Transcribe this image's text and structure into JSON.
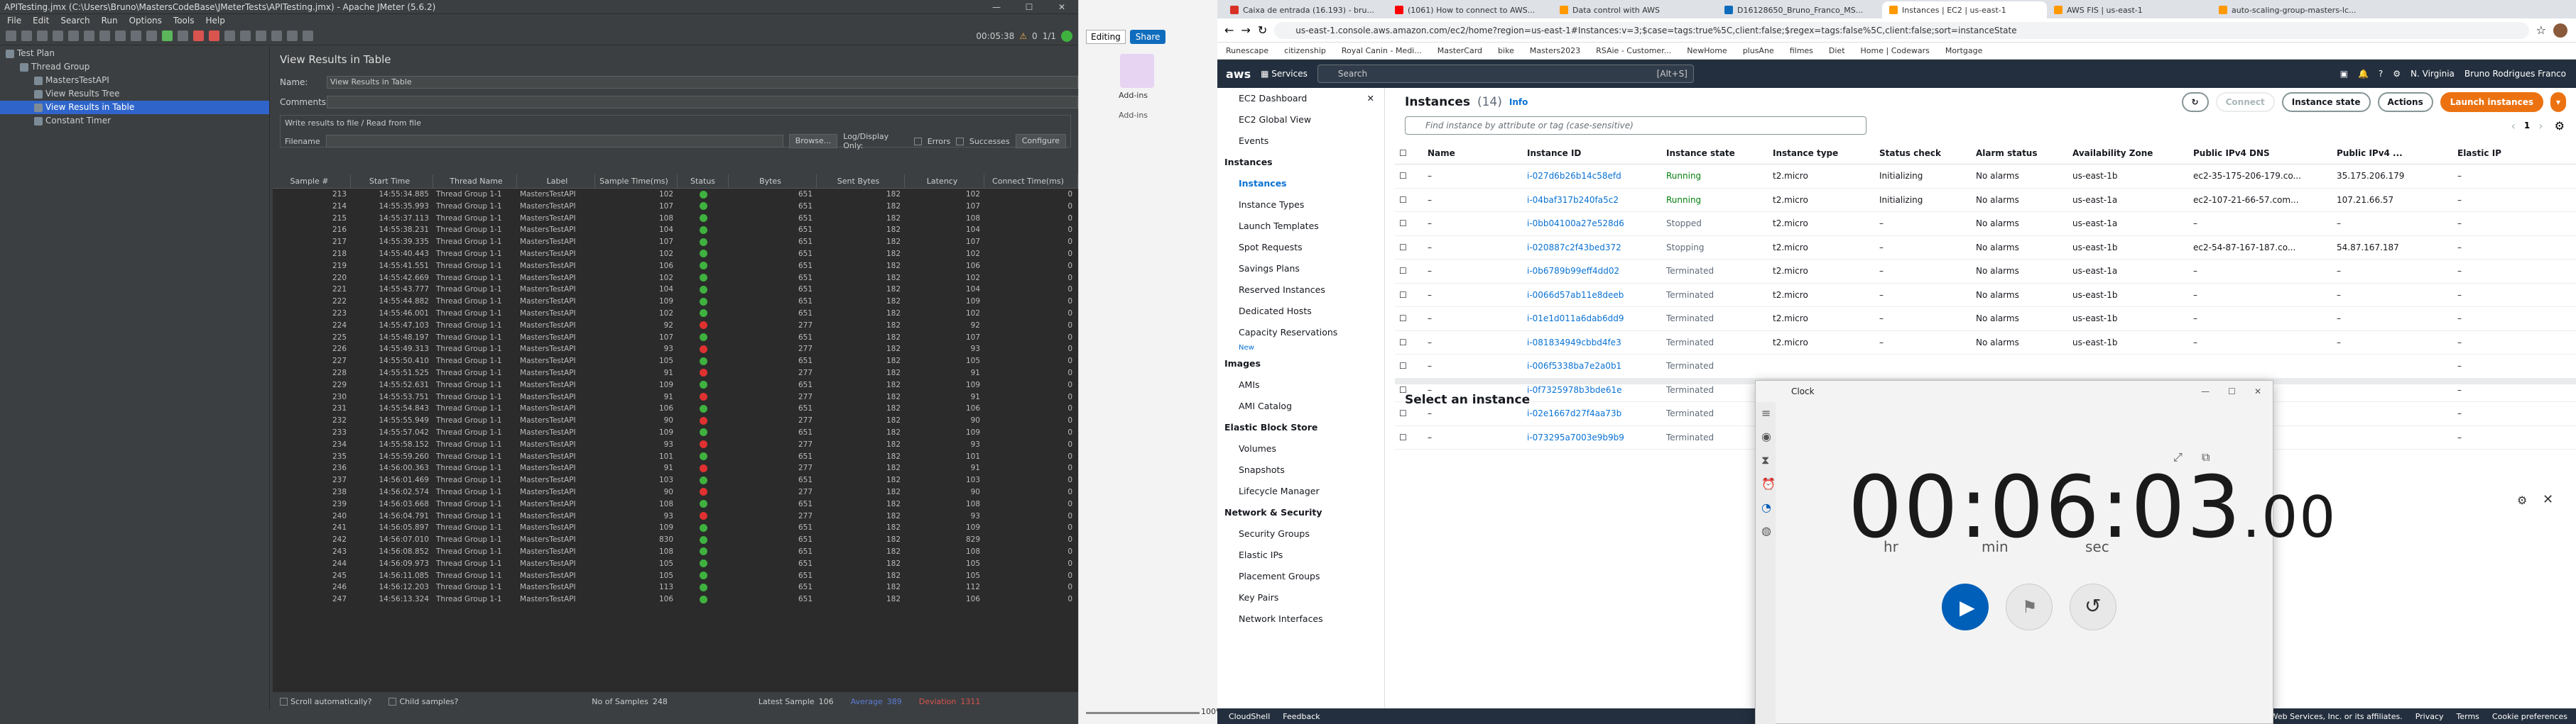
{
  "jmeter": {
    "title": "APITesting.jmx (C:\\Users\\Bruno\\MastersCodeBase\\JMeterTests\\APITesting.jmx) - Apache JMeter (5.6.2)",
    "menu": [
      "File",
      "Edit",
      "Search",
      "Run",
      "Options",
      "Tools",
      "Help"
    ],
    "timer": "00:05:38",
    "warn_count": "0",
    "threads": "1/1",
    "tree": [
      {
        "label": "Test Plan",
        "indent": 0,
        "sel": false
      },
      {
        "label": "Thread Group",
        "indent": 1,
        "sel": false
      },
      {
        "label": "MastersTestAPI",
        "indent": 2,
        "sel": false
      },
      {
        "label": "View Results Tree",
        "indent": 2,
        "sel": false
      },
      {
        "label": "View Results in Table",
        "indent": 2,
        "sel": true
      },
      {
        "label": "Constant Timer",
        "indent": 2,
        "sel": false
      }
    ],
    "panel_title": "View Results in Table",
    "name_label": "Name:",
    "name_value": "View Results in Table",
    "comments_label": "Comments:",
    "write_all": "Write results to file / Read from file",
    "filename_label": "Filename",
    "browse_label": "Browse...",
    "log_display": "Log/Display Only:",
    "errors_label": "Errors",
    "successes_label": "Successes",
    "configure_label": "Configure",
    "columns": [
      "Sample #",
      "Start Time",
      "Thread Name",
      "Label",
      "Sample Time(ms)",
      "Status",
      "Bytes",
      "Sent Bytes",
      "Latency",
      "Connect Time(ms)"
    ],
    "rows": [
      [
        "213",
        "14:55:34.885",
        "Thread Group 1-1",
        "MastersTestAPI",
        "102",
        "ok",
        "651",
        "182",
        "102",
        "0"
      ],
      [
        "214",
        "14:55:35.993",
        "Thread Group 1-1",
        "MastersTestAPI",
        "107",
        "ok",
        "651",
        "182",
        "107",
        "0"
      ],
      [
        "215",
        "14:55:37.113",
        "Thread Group 1-1",
        "MastersTestAPI",
        "108",
        "ok",
        "651",
        "182",
        "108",
        "0"
      ],
      [
        "216",
        "14:55:38.231",
        "Thread Group 1-1",
        "MastersTestAPI",
        "104",
        "ok",
        "651",
        "182",
        "104",
        "0"
      ],
      [
        "217",
        "14:55:39.335",
        "Thread Group 1-1",
        "MastersTestAPI",
        "107",
        "ok",
        "651",
        "182",
        "107",
        "0"
      ],
      [
        "218",
        "14:55:40.443",
        "Thread Group 1-1",
        "MastersTestAPI",
        "102",
        "ok",
        "651",
        "182",
        "102",
        "0"
      ],
      [
        "219",
        "14:55:41.551",
        "Thread Group 1-1",
        "MastersTestAPI",
        "106",
        "ok",
        "651",
        "182",
        "106",
        "0"
      ],
      [
        "220",
        "14:55:42.669",
        "Thread Group 1-1",
        "MastersTestAPI",
        "102",
        "ok",
        "651",
        "182",
        "102",
        "0"
      ],
      [
        "221",
        "14:55:43.777",
        "Thread Group 1-1",
        "MastersTestAPI",
        "104",
        "ok",
        "651",
        "182",
        "104",
        "0"
      ],
      [
        "222",
        "14:55:44.882",
        "Thread Group 1-1",
        "MastersTestAPI",
        "109",
        "ok",
        "651",
        "182",
        "109",
        "0"
      ],
      [
        "223",
        "14:55:46.001",
        "Thread Group 1-1",
        "MastersTestAPI",
        "102",
        "ok",
        "651",
        "182",
        "102",
        "0"
      ],
      [
        "224",
        "14:55:47.103",
        "Thread Group 1-1",
        "MastersTestAPI",
        "92",
        "bad",
        "277",
        "182",
        "92",
        "0"
      ],
      [
        "225",
        "14:55:48.197",
        "Thread Group 1-1",
        "MastersTestAPI",
        "107",
        "ok",
        "651",
        "182",
        "107",
        "0"
      ],
      [
        "226",
        "14:55:49.313",
        "Thread Group 1-1",
        "MastersTestAPI",
        "93",
        "bad",
        "277",
        "182",
        "93",
        "0"
      ],
      [
        "227",
        "14:55:50.410",
        "Thread Group 1-1",
        "MastersTestAPI",
        "105",
        "ok",
        "651",
        "182",
        "105",
        "0"
      ],
      [
        "228",
        "14:55:51.525",
        "Thread Group 1-1",
        "MastersTestAPI",
        "91",
        "bad",
        "277",
        "182",
        "91",
        "0"
      ],
      [
        "229",
        "14:55:52.631",
        "Thread Group 1-1",
        "MastersTestAPI",
        "109",
        "ok",
        "651",
        "182",
        "109",
        "0"
      ],
      [
        "230",
        "14:55:53.751",
        "Thread Group 1-1",
        "MastersTestAPI",
        "91",
        "bad",
        "277",
        "182",
        "91",
        "0"
      ],
      [
        "231",
        "14:55:54.843",
        "Thread Group 1-1",
        "MastersTestAPI",
        "106",
        "ok",
        "651",
        "182",
        "106",
        "0"
      ],
      [
        "232",
        "14:55:55.949",
        "Thread Group 1-1",
        "MastersTestAPI",
        "90",
        "bad",
        "277",
        "182",
        "90",
        "0"
      ],
      [
        "233",
        "14:55:57.042",
        "Thread Group 1-1",
        "MastersTestAPI",
        "109",
        "ok",
        "651",
        "182",
        "109",
        "0"
      ],
      [
        "234",
        "14:55:58.152",
        "Thread Group 1-1",
        "MastersTestAPI",
        "93",
        "bad",
        "277",
        "182",
        "93",
        "0"
      ],
      [
        "235",
        "14:55:59.260",
        "Thread Group 1-1",
        "MastersTestAPI",
        "101",
        "ok",
        "651",
        "182",
        "101",
        "0"
      ],
      [
        "236",
        "14:56:00.363",
        "Thread Group 1-1",
        "MastersTestAPI",
        "91",
        "bad",
        "277",
        "182",
        "91",
        "0"
      ],
      [
        "237",
        "14:56:01.469",
        "Thread Group 1-1",
        "MastersTestAPI",
        "103",
        "ok",
        "651",
        "182",
        "103",
        "0"
      ],
      [
        "238",
        "14:56:02.574",
        "Thread Group 1-1",
        "MastersTestAPI",
        "90",
        "bad",
        "277",
        "182",
        "90",
        "0"
      ],
      [
        "239",
        "14:56:03.668",
        "Thread Group 1-1",
        "MastersTestAPI",
        "108",
        "ok",
        "651",
        "182",
        "108",
        "0"
      ],
      [
        "240",
        "14:56:04.791",
        "Thread Group 1-1",
        "MastersTestAPI",
        "93",
        "bad",
        "277",
        "182",
        "93",
        "0"
      ],
      [
        "241",
        "14:56:05.897",
        "Thread Group 1-1",
        "MastersTestAPI",
        "109",
        "ok",
        "651",
        "182",
        "109",
        "0"
      ],
      [
        "242",
        "14:56:07.010",
        "Thread Group 1-1",
        "MastersTestAPI",
        "830",
        "ok",
        "651",
        "182",
        "829",
        "0"
      ],
      [
        "243",
        "14:56:08.852",
        "Thread Group 1-1",
        "MastersTestAPI",
        "108",
        "ok",
        "651",
        "182",
        "108",
        "0"
      ],
      [
        "244",
        "14:56:09.973",
        "Thread Group 1-1",
        "MastersTestAPI",
        "105",
        "ok",
        "651",
        "182",
        "105",
        "0"
      ],
      [
        "245",
        "14:56:11.085",
        "Thread Group 1-1",
        "MastersTestAPI",
        "105",
        "ok",
        "651",
        "182",
        "105",
        "0"
      ],
      [
        "246",
        "14:56:12.203",
        "Thread Group 1-1",
        "MastersTestAPI",
        "113",
        "ok",
        "651",
        "182",
        "112",
        "0"
      ],
      [
        "247",
        "14:56:13.324",
        "Thread Group 1-1",
        "MastersTestAPI",
        "106",
        "ok",
        "651",
        "182",
        "106",
        "0"
      ]
    ],
    "scroll_auto": "Scroll automatically?",
    "child_samples": "Child samples?",
    "no_samples_label": "No of Samples",
    "no_samples": "248",
    "latest_label": "Latest Sample",
    "latest": "106",
    "average_label": "Average",
    "average": "389",
    "deviation_label": "Deviation",
    "deviation": "1311"
  },
  "office": {
    "editing": "Editing",
    "share": "Share",
    "addins": "Add-ins",
    "addins2": "Add-ins",
    "zoom": "100%"
  },
  "chrome": {
    "tabs": [
      "Caixa de entrada (16.193) - bru...",
      "(1061) How to connect to AWS...",
      "Data control with AWS",
      "D16128650_Bruno_Franco_MS...",
      "Instances | EC2 | us-east-1",
      "AWS FIS | us-east-1",
      "auto-scaling-group-masters-lc..."
    ],
    "active_tab": 4,
    "url": "us-east-1.console.aws.amazon.com/ec2/home?region=us-east-1#Instances:v=3;$case=tags:true%5C,client:false;$regex=tags:false%5C,client:false;sort=instanceState",
    "bookmarks": [
      "Runescape",
      "citizenship",
      "Royal Canin - Medi...",
      "MasterCard",
      "bike",
      "Masters2023",
      "RSAie - Customer...",
      "NewHome",
      "plusAne",
      "filmes",
      "Diet",
      "Home | Codewars",
      "Mortgage"
    ]
  },
  "aws": {
    "services": "Services",
    "search_placeholder": "Search",
    "search_shortcut": "[Alt+S]",
    "region": "N. Virginia",
    "user": "Bruno Rodrigues Franco",
    "nav": [
      {
        "t": "EC2 Dashboard",
        "k": "item"
      },
      {
        "t": "EC2 Global View",
        "k": "item"
      },
      {
        "t": "Events",
        "k": "item"
      },
      {
        "t": "Instances",
        "k": "hd"
      },
      {
        "t": "Instances",
        "k": "on"
      },
      {
        "t": "Instance Types",
        "k": "item"
      },
      {
        "t": "Launch Templates",
        "k": "item"
      },
      {
        "t": "Spot Requests",
        "k": "item"
      },
      {
        "t": "Savings Plans",
        "k": "item"
      },
      {
        "t": "Reserved Instances",
        "k": "item"
      },
      {
        "t": "Dedicated Hosts",
        "k": "item"
      },
      {
        "t": "Capacity Reservations",
        "k": "item"
      },
      {
        "t": "New",
        "k": "new"
      },
      {
        "t": "Images",
        "k": "hd"
      },
      {
        "t": "AMIs",
        "k": "item"
      },
      {
        "t": "AMI Catalog",
        "k": "item"
      },
      {
        "t": "Elastic Block Store",
        "k": "hd"
      },
      {
        "t": "Volumes",
        "k": "item"
      },
      {
        "t": "Snapshots",
        "k": "item"
      },
      {
        "t": "Lifecycle Manager",
        "k": "item"
      },
      {
        "t": "Network & Security",
        "k": "hd"
      },
      {
        "t": "Security Groups",
        "k": "item"
      },
      {
        "t": "Elastic IPs",
        "k": "item"
      },
      {
        "t": "Placement Groups",
        "k": "item"
      },
      {
        "t": "Key Pairs",
        "k": "item"
      },
      {
        "t": "Network Interfaces",
        "k": "item"
      }
    ],
    "instances_title": "Instances",
    "instances_count": "(14)",
    "info": "Info",
    "connect": "Connect",
    "instance_state": "Instance state",
    "actions": "Actions",
    "launch": "Launch instances",
    "find_placeholder": "Find instance by attribute or tag (case-sensitive)",
    "page": "1",
    "columns": [
      "Name",
      "Instance ID",
      "Instance state",
      "Instance type",
      "Status check",
      "Alarm status",
      "Availability Zone",
      "Public IPv4 DNS",
      "Public IPv4 ...",
      "Elastic IP"
    ],
    "rows": [
      [
        "–",
        "i-027d6b26b14c58efd",
        "Running",
        "t2.micro",
        "Initializing",
        "No alarms",
        "us-east-1b",
        "ec2-35-175-206-179.co...",
        "35.175.206.179",
        "–"
      ],
      [
        "–",
        "i-04baf317b240fa5c2",
        "Running",
        "t2.micro",
        "Initializing",
        "No alarms",
        "us-east-1a",
        "ec2-107-21-66-57.com...",
        "107.21.66.57",
        "–"
      ],
      [
        "–",
        "i-0bb04100a27e528d6",
        "Stopped",
        "t2.micro",
        "–",
        "No alarms",
        "us-east-1a",
        "–",
        "–",
        "–"
      ],
      [
        "–",
        "i-020887c2f43bed372",
        "Stopping",
        "t2.micro",
        "–",
        "No alarms",
        "us-east-1b",
        "ec2-54-87-167-187.co...",
        "54.87.167.187",
        "–"
      ],
      [
        "–",
        "i-0b6789b99eff4dd02",
        "Terminated",
        "t2.micro",
        "–",
        "No alarms",
        "us-east-1a",
        "–",
        "–",
        "–"
      ],
      [
        "–",
        "i-0066d57ab11e8deeb",
        "Terminated",
        "t2.micro",
        "–",
        "No alarms",
        "us-east-1b",
        "–",
        "–",
        "–"
      ],
      [
        "–",
        "i-01e1d011a6dab6dd9",
        "Terminated",
        "t2.micro",
        "–",
        "No alarms",
        "us-east-1b",
        "–",
        "–",
        "–"
      ],
      [
        "–",
        "i-081834949cbbd4fe3",
        "Terminated",
        "t2.micro",
        "–",
        "No alarms",
        "us-east-1b",
        "–",
        "–",
        "–"
      ],
      [
        "–",
        "i-006f5338ba7e2a0b1",
        "Terminated",
        "",
        "",
        "",
        "",
        "",
        "",
        "–"
      ],
      [
        "–",
        "i-0f7325978b3bde61e",
        "Terminated",
        "",
        "",
        "",
        "",
        "",
        "",
        "–"
      ],
      [
        "–",
        "i-02e1667d27f4aa73b",
        "Terminated",
        "",
        "",
        "",
        "",
        "",
        "",
        "–"
      ],
      [
        "–",
        "i-073295a7003e9b9b9",
        "Terminated",
        "",
        "",
        "",
        "",
        "",
        "",
        "–"
      ]
    ],
    "select_instance": "Select an instance",
    "cloudshell": "CloudShell",
    "feedback": "Feedback",
    "copyright": "© 2023, Amazon Web Services, Inc. or its affiliates.",
    "privacy": "Privacy",
    "terms": "Terms",
    "cookie": "Cookie preferences"
  },
  "clock": {
    "title": "Clock",
    "hh": "00",
    "mm": "06",
    "ss": "03",
    "frac": ".00",
    "hr": "hr",
    "min": "min",
    "sec": "sec"
  }
}
